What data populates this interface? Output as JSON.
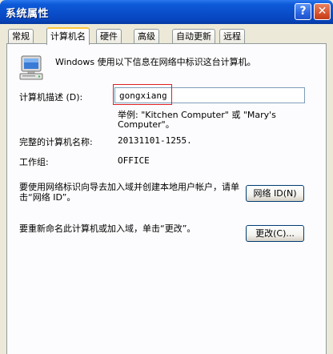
{
  "window": {
    "title": "系统属性"
  },
  "titlebar": {
    "help_glyph": "?",
    "close_glyph": "✕"
  },
  "tabs": [
    {
      "label": "常规",
      "active": false
    },
    {
      "label": "计算机名",
      "active": true
    },
    {
      "label": "硬件",
      "active": false
    },
    {
      "label": "高级",
      "active": false
    },
    {
      "label": "自动更新",
      "active": false
    },
    {
      "label": "远程",
      "active": false
    }
  ],
  "panel": {
    "intro": "Windows 使用以下信息在网络中标识这台计算机。",
    "description_label": "计算机描述 (D):",
    "description_value": "gongxiang",
    "example": "举例: \"Kitchen Computer\" 或 \"Mary's Computer\"。",
    "full_name_label": "完整的计算机名称:",
    "full_name_value": "20131101-1255.",
    "workgroup_label": "工作组:",
    "workgroup_value": "OFFICE",
    "network_id_text": "要使用网络标识向导去加入域并创建本地用户帐户，请单击“网络 ID”。",
    "network_id_button": "网络 ID(N)",
    "change_text": "要重新命名此计算机或加入域，单击“更改”。",
    "change_button": "更改(C)..."
  },
  "icons": {
    "computer": "computer-icon"
  }
}
